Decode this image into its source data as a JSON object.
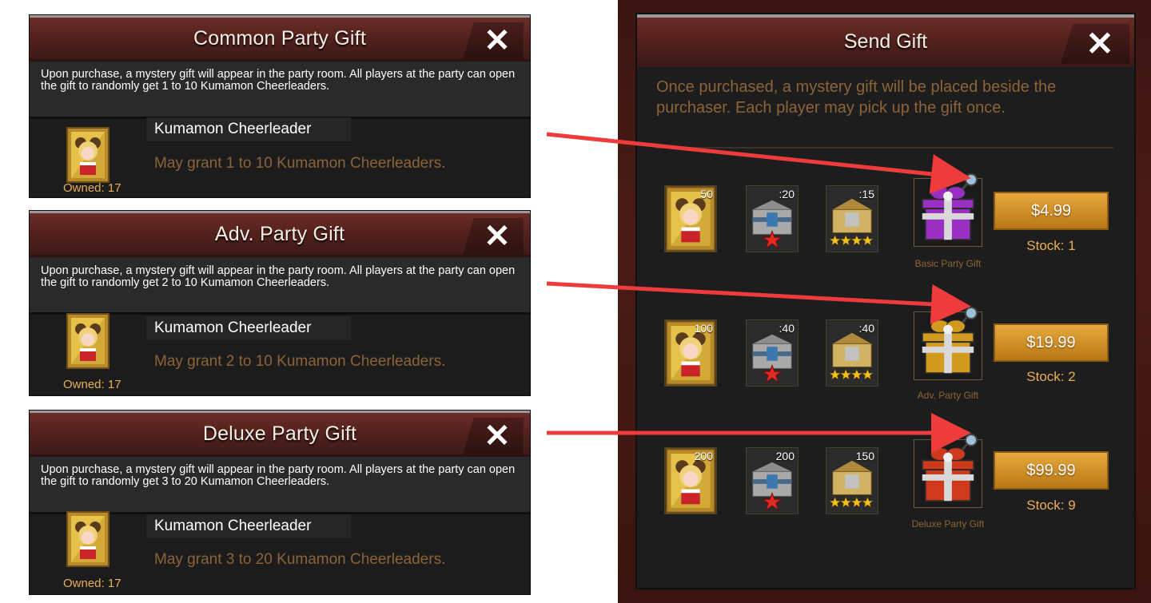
{
  "info_panels": [
    {
      "title": "Common Party Gift",
      "description": "Upon purchase, a mystery gift will appear in the party room. All players at the party can open the gift to randomly get 1 to 10 Kumamon Cheerleaders.",
      "item_name": "Kumamon Cheerleader",
      "grant_text": "May grant 1 to 10 Kumamon Cheerleaders.",
      "owned": "Owned: 17",
      "close_label": "✕"
    },
    {
      "title": "Adv. Party Gift",
      "description": "Upon purchase, a mystery gift will appear in the party room. All players at the party can open the gift to randomly get 2 to 10 Kumamon Cheerleaders.",
      "item_name": "Kumamon Cheerleader",
      "grant_text": "May grant 2 to 10 Kumamon Cheerleaders.",
      "owned": "Owned: 17",
      "close_label": "✕"
    },
    {
      "title": "Deluxe Party Gift",
      "description": "Upon purchase, a mystery gift will appear in the party room. All players at the party can open the gift to randomly get 3 to 20 Kumamon Cheerleaders.",
      "item_name": "Kumamon Cheerleader",
      "grant_text": "May grant 3 to 20 Kumamon Cheerleaders.",
      "owned": "Owned: 17",
      "close_label": "✕"
    }
  ],
  "send_gift": {
    "title": "Send Gift",
    "close_label": "✕",
    "description": "Once purchased, a mystery gift will be placed beside the purchaser. Each player may pick up the gift once.",
    "offers": [
      {
        "items": [
          {
            "icon": "cheerleader-portrait-icon",
            "qty": "50"
          },
          {
            "icon": "silver-chest-1star-icon",
            "qty": ":20"
          },
          {
            "icon": "gold-chest-4star-icon",
            "qty": ":15"
          }
        ],
        "gift_icon": "purple-gift-box-icon",
        "gift_label": "Basic Party Gift",
        "price": "$4.99",
        "stock": "Stock: 1"
      },
      {
        "items": [
          {
            "icon": "cheerleader-portrait-icon",
            "qty": "100"
          },
          {
            "icon": "silver-chest-1star-icon",
            "qty": ":40"
          },
          {
            "icon": "gold-chest-4star-icon",
            "qty": ":40"
          }
        ],
        "gift_icon": "gold-gift-box-icon",
        "gift_label": "Adv. Party Gift",
        "price": "$19.99",
        "stock": "Stock: 2"
      },
      {
        "items": [
          {
            "icon": "cheerleader-portrait-icon",
            "qty": "200"
          },
          {
            "icon": "silver-chest-1star-icon",
            "qty": "200"
          },
          {
            "icon": "gold-chest-4star-icon",
            "qty": "150"
          }
        ],
        "gift_icon": "red-gift-box-icon",
        "gift_label": "Deluxe Party Gift",
        "price": "$99.99",
        "stock": "Stock: 9"
      }
    ]
  },
  "colors": {
    "header_red": "#54211d",
    "panel_dark": "#1c1c1c",
    "accent_orange": "#e8ae58",
    "muted_brown_text": "#8c6438",
    "button_gold": "#d6952c",
    "arrow_red": "#ee3b3b"
  }
}
